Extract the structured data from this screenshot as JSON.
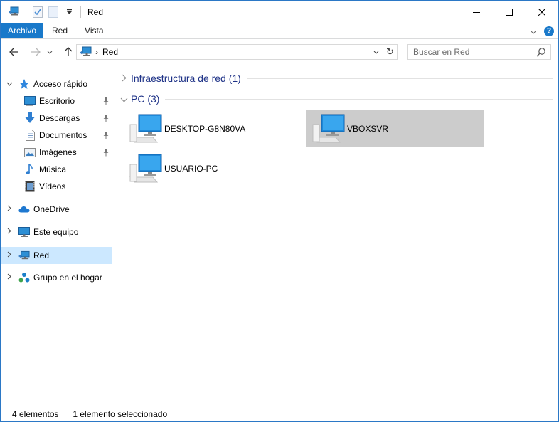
{
  "window": {
    "title": "Red",
    "controls": {
      "minimize": "—",
      "maximize": "☐",
      "close": "✕"
    }
  },
  "ribbon": {
    "tabs": [
      {
        "label": "Archivo"
      },
      {
        "label": "Red"
      },
      {
        "label": "Vista"
      }
    ],
    "expand": "⌄",
    "help": "?"
  },
  "navigation": {
    "back": "←",
    "forward": "→",
    "recent": "⌄",
    "up": "↑",
    "address": {
      "separator": "›",
      "location": "Red",
      "dropdown": "⌄",
      "refresh": "↻"
    },
    "search": {
      "placeholder": "Buscar en Red"
    }
  },
  "sidebar": {
    "quick_access": {
      "label": "Acceso rápido",
      "chevron": "⌄"
    },
    "quick_items": [
      {
        "label": "Escritorio",
        "icon": "desktop-icon",
        "pinned": true
      },
      {
        "label": "Descargas",
        "icon": "downloads-icon",
        "pinned": true
      },
      {
        "label": "Documentos",
        "icon": "documents-icon",
        "pinned": true
      },
      {
        "label": "Imágenes",
        "icon": "pictures-icon",
        "pinned": true
      },
      {
        "label": "Música",
        "icon": "music-icon",
        "pinned": false
      },
      {
        "label": "Vídeos",
        "icon": "videos-icon",
        "pinned": false
      }
    ],
    "roots": [
      {
        "label": "OneDrive",
        "icon": "onedrive-icon",
        "chevron": "›"
      },
      {
        "label": "Este equipo",
        "icon": "computer-icon",
        "chevron": "›"
      },
      {
        "label": "Red",
        "icon": "network-icon",
        "chevron": "›",
        "selected": true
      },
      {
        "label": "Grupo en el hogar",
        "icon": "homegroup-icon",
        "chevron": "›"
      }
    ]
  },
  "content": {
    "groups": [
      {
        "title": "Infraestructura de red (1)",
        "chevron": "›",
        "collapsed": true
      },
      {
        "title": "PC (3)",
        "chevron": "⌄",
        "collapsed": false
      }
    ],
    "computers": [
      {
        "name": "DESKTOP-G8N80VA",
        "selected": false
      },
      {
        "name": "VBOXSVR",
        "selected": true
      },
      {
        "name": "USUARIO-PC",
        "selected": false
      }
    ]
  },
  "status": {
    "count": "4 elementos",
    "selection": "1 elemento seleccionado"
  },
  "colors": {
    "accent": "#1979ca",
    "selected_nav": "#cce8ff",
    "selected_tile": "#cccccc",
    "group_title": "#1e3287"
  }
}
